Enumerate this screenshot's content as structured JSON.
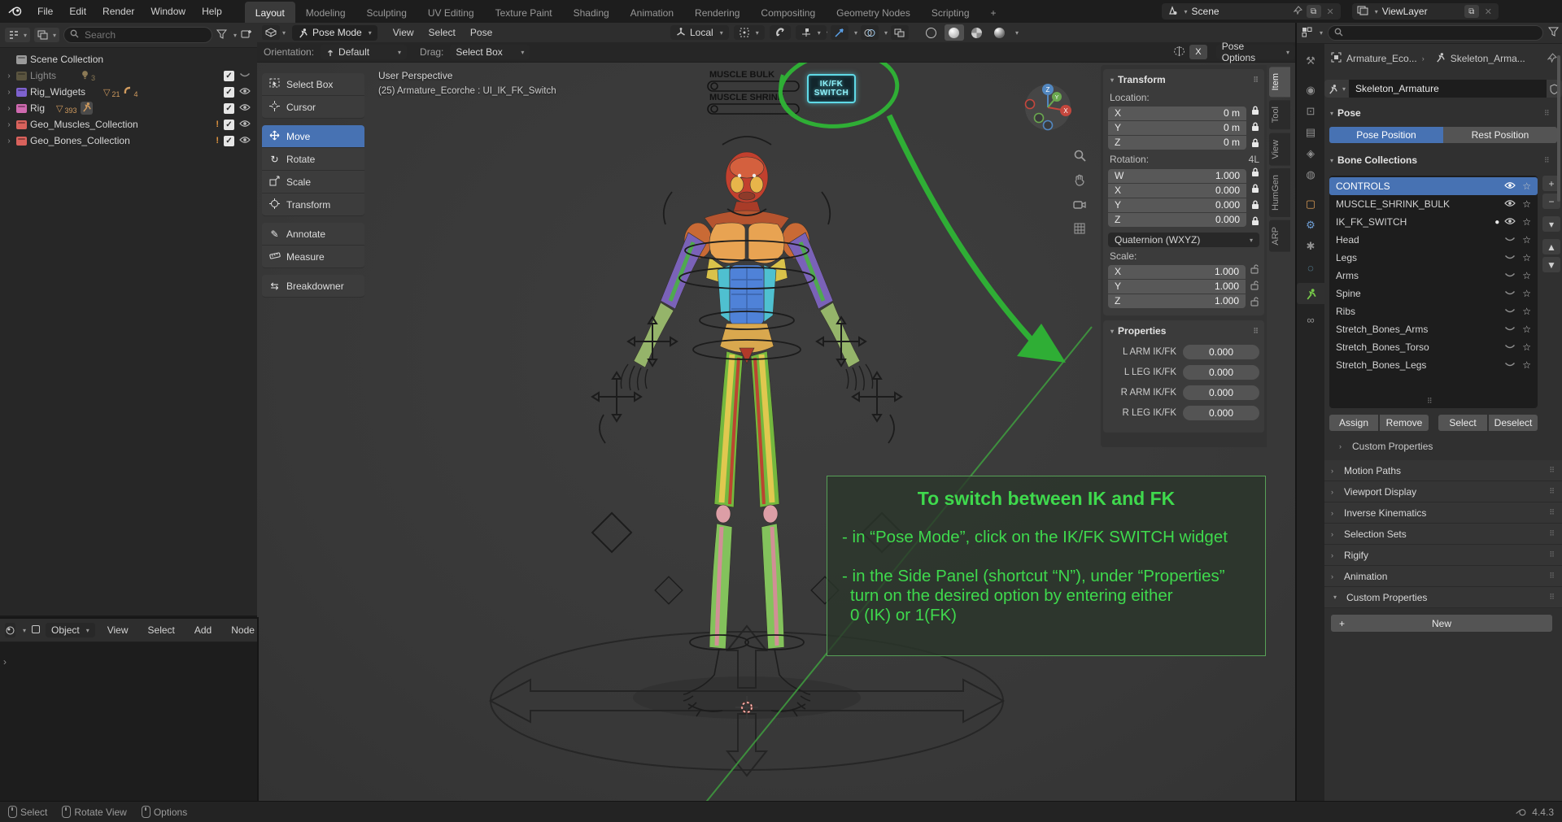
{
  "topbar": {
    "menus": [
      "File",
      "Edit",
      "Render",
      "Window",
      "Help"
    ],
    "workspaces": [
      "Layout",
      "Modeling",
      "Sculpting",
      "UV Editing",
      "Texture Paint",
      "Shading",
      "Animation",
      "Rendering",
      "Compositing",
      "Geometry Nodes",
      "Scripting",
      "+"
    ],
    "scene_selector": "Scene",
    "view_layer_selector": "ViewLayer"
  },
  "outliner": {
    "search_placeholder": "Search",
    "rows": [
      {
        "label": "Scene Collection"
      },
      {
        "label": "Lights",
        "count": "3"
      },
      {
        "label": "Rig_Widgets",
        "mesh_count": "21",
        "curve_count": "4"
      },
      {
        "label": "Rig",
        "mesh_count": "393"
      },
      {
        "label": "Geo_Muscles_Collection"
      },
      {
        "label": "Geo_Bones_Collection"
      }
    ]
  },
  "tools": {
    "items": [
      "Select Box",
      "Cursor",
      "Move",
      "Rotate",
      "Scale",
      "Transform",
      "Annotate",
      "Measure",
      "Breakdowner"
    ],
    "active": "Move"
  },
  "viewport": {
    "mode": "Pose Mode",
    "menus": [
      "View",
      "Select",
      "Pose"
    ],
    "orientation_label": "Orientation:",
    "orientation": "Default",
    "drag_label": "Drag:",
    "drag": "Select Box",
    "transform_space": "Local",
    "mirror_label": "X",
    "pose_options_label": "Pose Options",
    "info_line1": "User Perspective",
    "info_line2": "(25) Armature_Ecorche : UI_IK_FK_Switch",
    "muscle_bulk_label": "MUSCLE  BULK",
    "muscle_shrink_label": "MUSCLE SHRINK",
    "ikfk_widget": {
      "line1": "IK/FK",
      "line2": "SWITCH",
      "color": "#8df0f8"
    },
    "gizmo": {
      "z": "Z",
      "x": "X",
      "y": "Y"
    },
    "annotation_color": "#2fae35"
  },
  "note": {
    "title": "To switch between IK and FK",
    "bullet1": "- in “Pose Mode”, click on the IK/FK SWITCH widget",
    "bullet2_line1": "- in the Side Panel (shortcut “N”), under “Properties”",
    "bullet2_line2": "turn on the desired option by entering either",
    "bullet2_line3": "0 (IK) or 1(FK)",
    "text_color": "#3fd94d"
  },
  "n_panel": {
    "tabs": [
      "Item",
      "Tool",
      "View",
      "HumGen",
      "ARP"
    ],
    "active_tab": "Item",
    "transform": {
      "title": "Transform",
      "location_label": "Location:",
      "location_rows": [
        {
          "axis": "X",
          "value": "0 m"
        },
        {
          "axis": "Y",
          "value": "0 m"
        },
        {
          "axis": "Z",
          "value": "0 m"
        }
      ],
      "rotation_label": "Rotation:",
      "rotation_indicator": "4L",
      "rotation_rows": [
        {
          "axis": "W",
          "value": "1.000"
        },
        {
          "axis": "X",
          "value": "0.000"
        },
        {
          "axis": "Y",
          "value": "0.000"
        },
        {
          "axis": "Z",
          "value": "0.000"
        }
      ],
      "rotation_mode": "Quaternion (WXYZ)",
      "scale_label": "Scale:",
      "scale_rows": [
        {
          "axis": "X",
          "value": "1.000"
        },
        {
          "axis": "Y",
          "value": "1.000"
        },
        {
          "axis": "Z",
          "value": "1.000"
        }
      ]
    },
    "properties": {
      "title": "Properties",
      "rows": [
        {
          "label": "L ARM IK/FK",
          "value": "0.000"
        },
        {
          "label": "L LEG IK/FK",
          "value": "0.000"
        },
        {
          "label": "R ARM IK/FK",
          "value": "0.000"
        },
        {
          "label": "R LEG IK/FK",
          "value": "0.000"
        }
      ]
    }
  },
  "properties_editor": {
    "breadcrumb": {
      "object": "Armature_Eco...",
      "data": "Skeleton_Arma..."
    },
    "name_field": "Skeleton_Armature",
    "pose_panel": {
      "title": "Pose",
      "pose_position": "Pose Position",
      "rest_position": "Rest Position",
      "active": "Pose Position"
    },
    "bone_collections": {
      "title": "Bone Collections",
      "rows": [
        {
          "name": "CONTROLS",
          "selected": true,
          "visible": true
        },
        {
          "name": "MUSCLE_SHRINK_BULK",
          "visible": true
        },
        {
          "name": "IK_FK_SWITCH",
          "visible": true,
          "active_dot": true
        },
        {
          "name": "Head",
          "visible": false
        },
        {
          "name": "Legs",
          "visible": false
        },
        {
          "name": "Arms",
          "visible": false
        },
        {
          "name": "Spine",
          "visible": false
        },
        {
          "name": "Ribs",
          "visible": false
        },
        {
          "name": "Stretch_Bones_Arms",
          "visible": false
        },
        {
          "name": "Stretch_Bones_Torso",
          "visible": false
        },
        {
          "name": "Stretch_Bones_Legs",
          "visible": false
        }
      ],
      "buttons": [
        "Assign",
        "Remove",
        "Select",
        "Deselect"
      ]
    },
    "sub_panel": "Custom Properties",
    "collapsed_panels": [
      "Motion Paths",
      "Viewport Display",
      "Inverse Kinematics",
      "Selection Sets",
      "Rigify",
      "Animation"
    ],
    "custom_properties": {
      "title": "Custom Properties",
      "new_button": "New"
    }
  },
  "node_editor": {
    "object_selector": "Object",
    "menus": [
      "View",
      "Select",
      "Add",
      "Node"
    ]
  },
  "status_bar": {
    "items": [
      "Select",
      "Rotate View",
      "Options"
    ],
    "version": "4.4.3"
  }
}
